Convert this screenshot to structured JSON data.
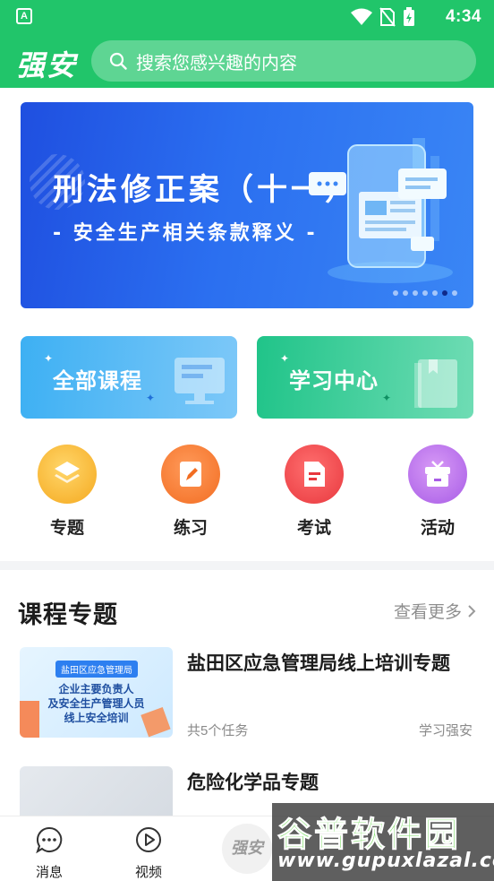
{
  "status_bar": {
    "app_icon": "A",
    "icons": [
      "wifi-icon",
      "no-sim-icon",
      "battery-charging-icon"
    ],
    "time": "4:34"
  },
  "header": {
    "logo": "强安",
    "search_placeholder": "搜索您感兴趣的内容",
    "background_color": "#21c56a"
  },
  "banner": {
    "title": "刑法修正案（十一）",
    "subtitle": "- 安全生产相关条款释义 -",
    "dots_total": 7,
    "dot_active_index": 5
  },
  "feature_cards": [
    {
      "label": "全部课程"
    },
    {
      "label": "学习中心"
    }
  ],
  "quick_actions": [
    {
      "label": "专题",
      "icon": "layers-icon",
      "color": "#f5a91f"
    },
    {
      "label": "练习",
      "icon": "edit-icon",
      "color": "#f26d22"
    },
    {
      "label": "考试",
      "icon": "document-icon",
      "color": "#e8383e"
    },
    {
      "label": "活动",
      "icon": "gift-icon",
      "color": "#a85ce6"
    }
  ],
  "section": {
    "title": "课程专题",
    "more_label": "查看更多"
  },
  "courses": [
    {
      "title": "盐田区应急管理局线上培训专题",
      "tasks": "共5个任务",
      "source": "学习强安",
      "thumb_tag": "盐田区应急管理局",
      "thumb_lines": [
        "企业主要负责人",
        "及安全生产管理人员",
        "线上安全培训"
      ]
    },
    {
      "title": "危险化学品专题"
    }
  ],
  "tab_bar": {
    "items": [
      {
        "label": "消息",
        "icon": "chat-icon"
      },
      {
        "label": "视频",
        "icon": "play-icon"
      }
    ],
    "center_logo": "强安"
  },
  "watermark": {
    "title": "谷普软件园",
    "url": "www.gupuxlazal.com"
  }
}
